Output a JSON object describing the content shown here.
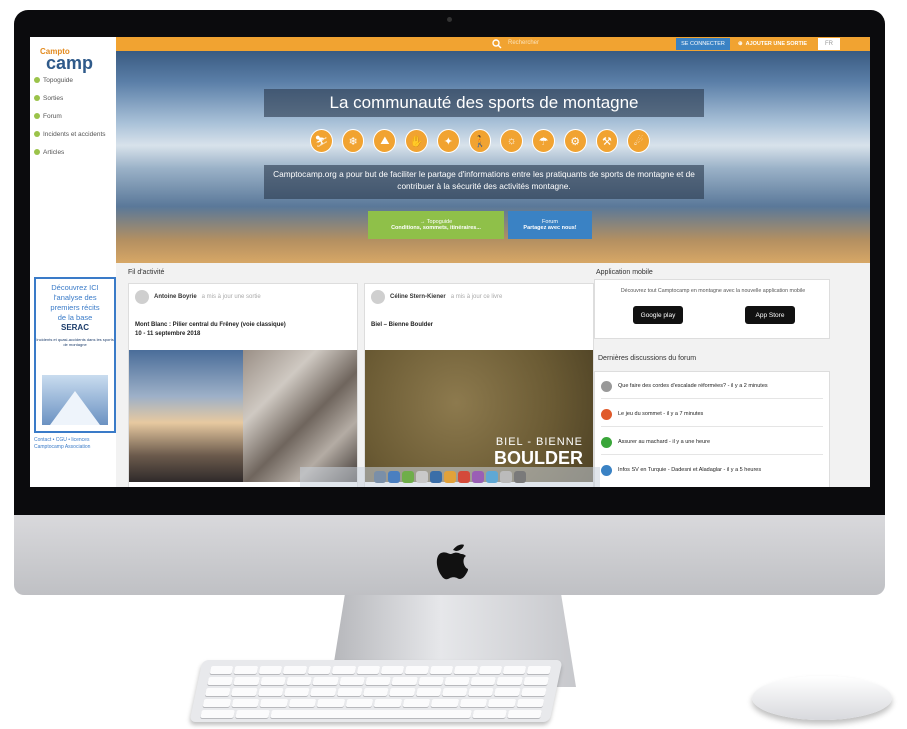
{
  "topbar": {
    "search_placeholder": "Rechercher",
    "connect_label": "SE CONNECTER",
    "add_outing_label": "AJOUTER UNE SORTIE",
    "language": "FR"
  },
  "sidebar": {
    "logo_text": "camp",
    "logo_small": "Campto",
    "items": [
      {
        "label": "Topoguide"
      },
      {
        "label": "Sorties"
      },
      {
        "label": "Forum"
      },
      {
        "label": "Incidents et accidents"
      },
      {
        "label": "Articles"
      }
    ],
    "promo": {
      "line1": "Découvrez ICI",
      "line2": "l'analyse des",
      "line3": "premiers récits",
      "line4": "de la base",
      "line5": "SERAC",
      "line6": "Incidents et quasi-accidents dans les sports de montagne"
    },
    "footer": "Contact • CGU • licences Camptocamp Association"
  },
  "hero": {
    "title": "La communauté des sports de montagne",
    "tagline": "Camptocamp.org a pour but de faciliter le partage d'informations entre les pratiquants de sports de montagne et de contribuer à la sécurité des activités montagne.",
    "topo_button": {
      "line1": "→ Topoguide",
      "line2": "Conditions, sommets, itinéraires..."
    },
    "forum_button": {
      "line1": "Forum",
      "line2": "Partagez avec nous!"
    }
  },
  "feed": {
    "title": "Fil d'activité",
    "cards": [
      {
        "author": "Antoine Boyrie",
        "action": "a mis à jour une sortie",
        "title": "Mont Blanc : Pilier central du Frêney (voie classique)",
        "date": "10 - 11 septembre 2018"
      },
      {
        "author": "Céline Stern-Kiener",
        "action": "a mis à jour ce livre",
        "title": "Biel – Bienne Boulder",
        "image_line1": "BIEL - BIENNE",
        "image_line2": "BOULDER"
      }
    ]
  },
  "app": {
    "title": "Application mobile",
    "text": "Découvrez tout Camptocamp en montagne avec la nouvelle application mobile",
    "google_play": "Google play",
    "app_store": "App Store"
  },
  "forum": {
    "title": "Dernières discussions du forum",
    "items": [
      {
        "text": "Que faire des cordes d'escalade réformées? - il y a 2 minutes"
      },
      {
        "text": "Le jeu du sommet - il y a 7 minutes"
      },
      {
        "text": "Assurer au machard - il y a une heure"
      },
      {
        "text": "Infos SV en Turquie - Dadesni et Aladaglar - il y a 5 heures"
      }
    ]
  },
  "colors": {
    "accent": "#f1a331",
    "blue": "#3a82c4",
    "green": "#8fc049"
  }
}
